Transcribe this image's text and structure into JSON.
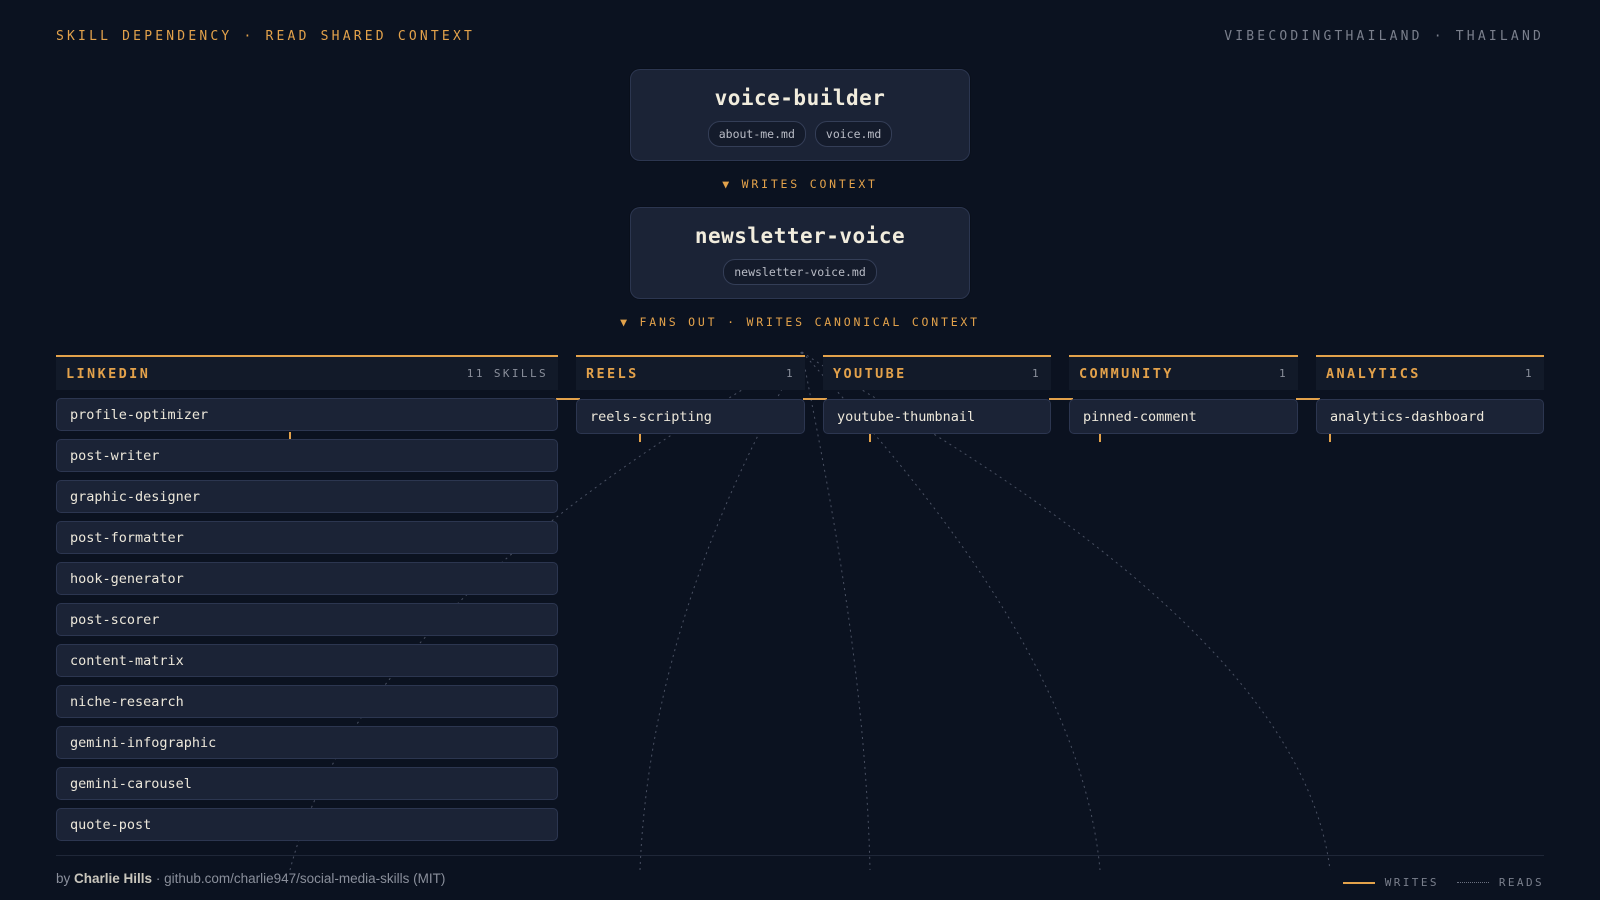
{
  "header": {
    "title": "SKILL DEPENDENCY · READ SHARED CONTEXT",
    "brand": "VIBECODINGTHAILAND · THAILAND"
  },
  "root": {
    "name": "voice-builder",
    "files": [
      "about-me.md",
      "voice.md"
    ]
  },
  "link_1": "▼ WRITES CONTEXT",
  "hub": {
    "name": "newsletter-voice",
    "files": [
      "newsletter-voice.md"
    ]
  },
  "link_2": "▼ FANS OUT · WRITES CANONICAL CONTEXT",
  "columns": [
    {
      "name": "LINKEDIN",
      "count": "11 SKILLS",
      "skills": [
        "profile-optimizer",
        "post-writer",
        "graphic-designer",
        "post-formatter",
        "hook-generator",
        "post-scorer",
        "content-matrix",
        "niche-research",
        "gemini-infographic",
        "gemini-carousel",
        "quote-post"
      ]
    },
    {
      "name": "REELS",
      "count": "1",
      "skills": [
        "reels-scripting"
      ]
    },
    {
      "name": "YOUTUBE",
      "count": "1",
      "skills": [
        "youtube-thumbnail"
      ]
    },
    {
      "name": "COMMUNITY",
      "count": "1",
      "skills": [
        "pinned-comment"
      ]
    },
    {
      "name": "ANALYTICS",
      "count": "1",
      "skills": [
        "analytics-dashboard"
      ]
    }
  ],
  "footer": {
    "by": "by",
    "author": "Charlie Hills",
    "repo": "· github.com/charlie947/social-media-skills (MIT)"
  },
  "legend": {
    "writes": "WRITES",
    "reads": "READS"
  },
  "colors": {
    "background": "#0b1220",
    "accent": "#e3a24b",
    "card": "#1b2336",
    "card_border": "#2c3650",
    "muted": "#7a7f8c"
  }
}
